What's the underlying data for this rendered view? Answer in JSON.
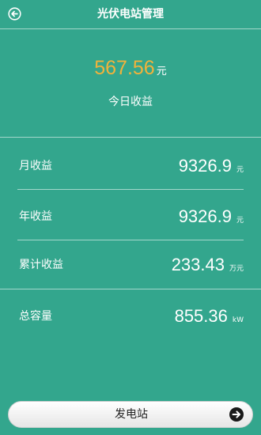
{
  "header": {
    "title": "光伏电站管理",
    "back_icon": "back-arrow-circle-icon"
  },
  "today": {
    "amount": "567.56",
    "unit": "元",
    "label": "今日收益"
  },
  "stats": [
    {
      "label": "月收益",
      "value": "9326.9",
      "unit": "元"
    },
    {
      "label": "年收益",
      "value": "9326.9",
      "unit": "元"
    },
    {
      "label": "累计收益",
      "value": "233.43",
      "unit": "万元"
    },
    {
      "label": "总容量",
      "value": "855.36",
      "unit": "kW"
    }
  ],
  "footer": {
    "button_label": "发电站",
    "button_icon": "arrow-right-circle-icon"
  },
  "colors": {
    "background": "#33a68d",
    "accent": "#f2b23a"
  }
}
